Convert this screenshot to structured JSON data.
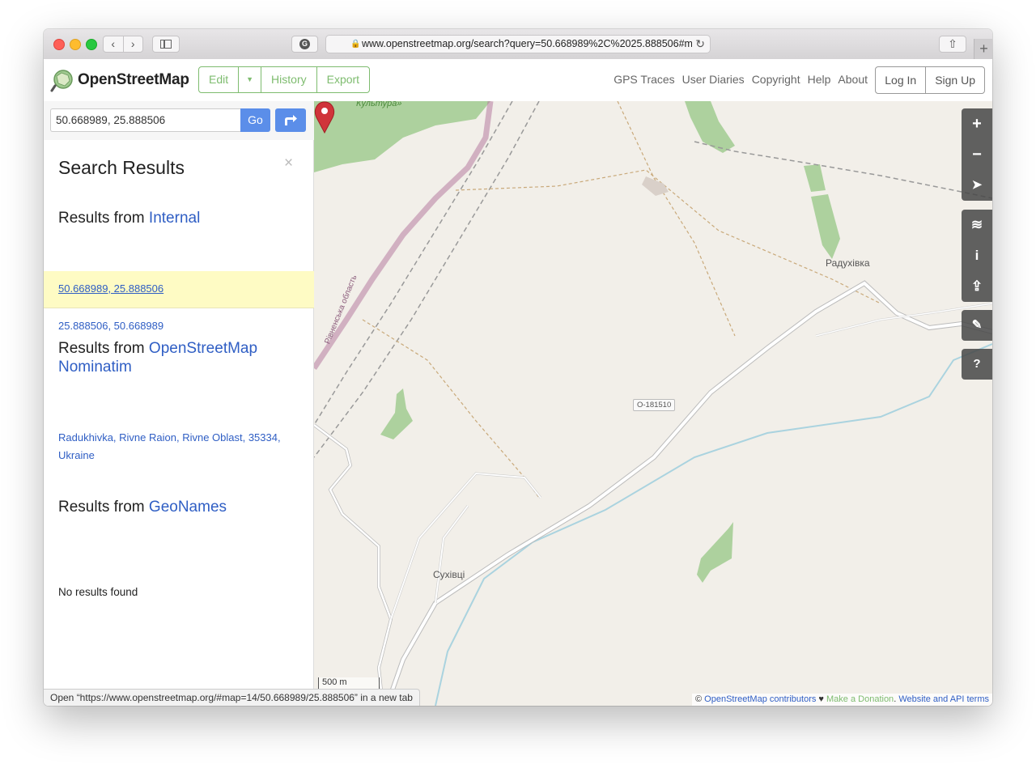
{
  "browser": {
    "url": "www.openstreetmap.org/search?query=50.668989%2C%2025.888506#m",
    "new_tab": "+",
    "back": "‹",
    "forward": "›",
    "share": "⇧",
    "reload": "↻",
    "grammarly": "G"
  },
  "header": {
    "brand": "OpenStreetMap",
    "edit": "Edit",
    "history": "History",
    "export": "Export",
    "nav": [
      "GPS Traces",
      "User Diaries",
      "Copyright",
      "Help",
      "About"
    ],
    "login": "Log In",
    "signup": "Sign Up"
  },
  "search": {
    "value": "50.668989, 25.888506",
    "go": "Go"
  },
  "results": {
    "title": "Search Results",
    "close": "×",
    "from": "Results from",
    "internal": {
      "source": "Internal",
      "items": [
        "50.668989, 25.888506",
        "25.888506, 50.668989"
      ]
    },
    "nominatim": {
      "source": "OpenStreetMap Nominatim",
      "items": [
        "Radukhivka, Rivne Raion, Rivne Oblast, 35334, Ukraine"
      ]
    },
    "geonames": {
      "source": "GeoNames",
      "empty": "No results found"
    }
  },
  "map": {
    "labels": {
      "kultura": "Культура»",
      "radukhivka": "Радухівка",
      "sukhivtsi": "Сухівці",
      "oblast": "Рівненська область"
    },
    "road_ref": "О-181510",
    "scale": "500 m",
    "controls": [
      "+",
      "−",
      "➤",
      "≋",
      "i",
      "⇪",
      "✎",
      "?"
    ],
    "attribution": {
      "prefix": "© ",
      "contributors": "OpenStreetMap contributors",
      "heart": " ♥ ",
      "donate": "Make a Donation",
      "sep": ". ",
      "terms": "Website and API terms"
    },
    "colors": {
      "land": "#f2efe9",
      "forest": "#add19e",
      "road": "#ffffff",
      "water": "#aad3df",
      "boundary": "#b67ba1",
      "marker": "#d0343a"
    }
  },
  "status": {
    "text": "Open “https://www.openstreetmap.org/#map=14/50.668989/25.888506” in a new tab"
  }
}
